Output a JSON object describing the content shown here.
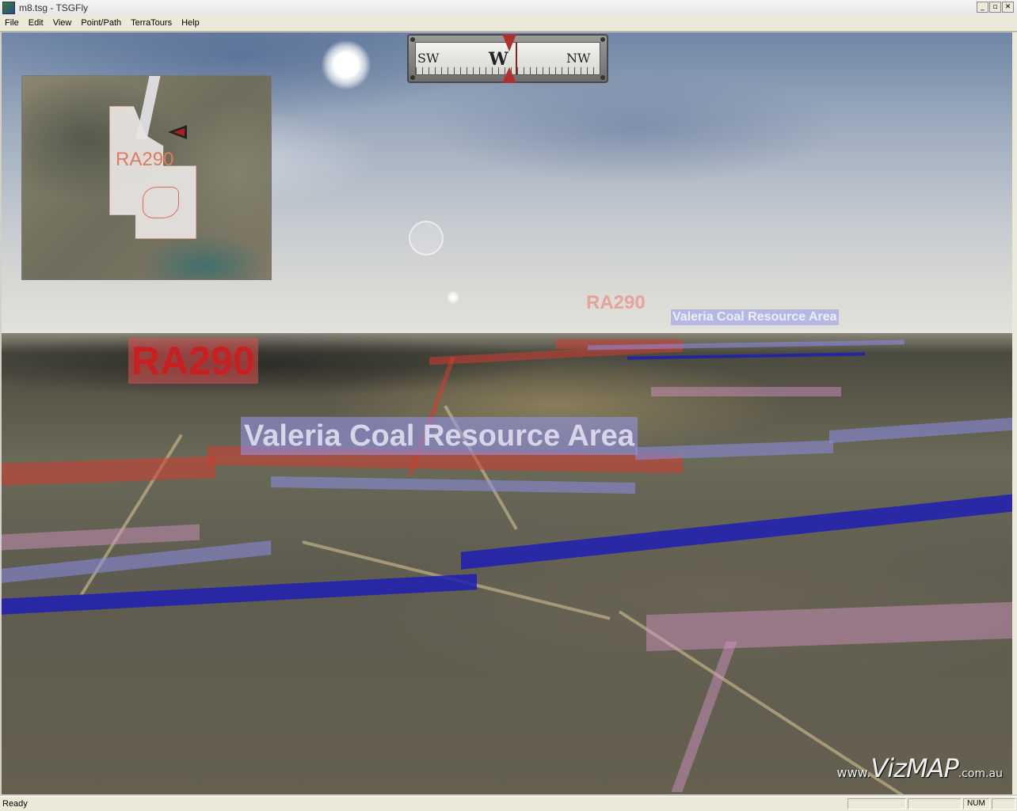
{
  "window": {
    "title": "m8.tsg - TSGFly",
    "minimize": "_",
    "maximize": "▫",
    "close": "✕"
  },
  "menu": [
    "File",
    "Edit",
    "View",
    "Point/Path",
    "TerraTours",
    "Help"
  ],
  "compass": {
    "left": "SW",
    "center": "W",
    "right": "NW"
  },
  "inset_map": {
    "label": "RA290"
  },
  "labels": {
    "ra290_near": "RA290",
    "ra290_far": "RA290",
    "valeria_near": "Valeria Coal Resource Area",
    "valeria_far": "Valeria Coal Resource Area"
  },
  "watermark": {
    "prefix": "www.",
    "main": "VizMAP",
    "suffix": ".com.au"
  },
  "status": {
    "text": "Ready",
    "num": "NUM"
  }
}
